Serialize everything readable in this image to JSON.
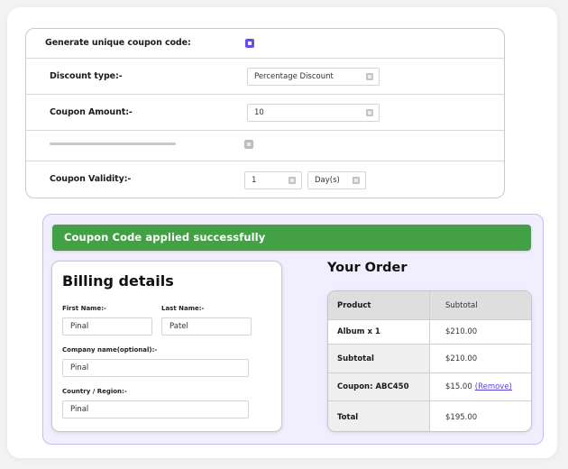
{
  "coupon_settings": {
    "generate_unique": {
      "label": "Generate unique coupon code:",
      "checked": true
    },
    "discount_type": {
      "label": "Discount type:-",
      "value": "Percentage Discount"
    },
    "coupon_amount": {
      "label": "Coupon Amount:-",
      "value": "10"
    },
    "unlabeled_row": {
      "checked": false
    },
    "coupon_validity": {
      "label": "Coupon Validity:-",
      "value": "1",
      "unit": "Day(s)"
    }
  },
  "checkout": {
    "success_message": "Coupon Code applied successfully",
    "billing": {
      "title": "Billing details",
      "first_name": {
        "label": "First Name:-",
        "value": "Pinal"
      },
      "last_name": {
        "label": "Last Name:-",
        "value": "Patel"
      },
      "company": {
        "label": "Company name(optional):-",
        "value": "Pinal"
      },
      "country": {
        "label": "Country / Region:-",
        "value": "Pinal"
      }
    },
    "order": {
      "title": "Your Order",
      "headers": [
        "Product",
        "Subtotal"
      ],
      "rows": [
        {
          "label": "Album x 1",
          "value": "$210.00"
        },
        {
          "label": "Subtotal",
          "value": "$210.00"
        },
        {
          "label": "Coupon: ABC450",
          "value": "$15.00",
          "link": "(Remove)"
        },
        {
          "label": "Total",
          "value": "$195.00"
        }
      ]
    }
  },
  "colors": {
    "accent": "#6a4af5",
    "success": "#44a044",
    "panel_bg": "#f1efff",
    "panel_border": "#c6bbf7",
    "link": "#5b3fe0"
  }
}
